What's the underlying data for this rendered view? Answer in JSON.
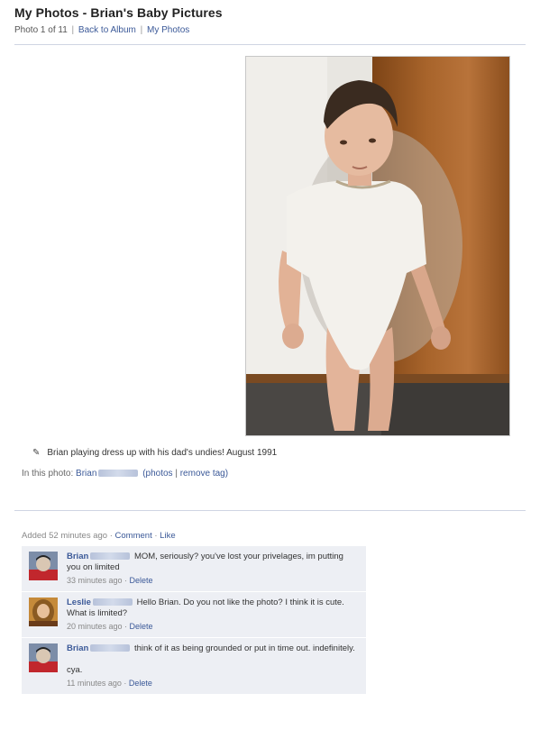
{
  "header": {
    "title": "My Photos - Brian's Baby Pictures",
    "photo_counter": "Photo 1 of 11",
    "back_link": "Back to Album",
    "my_photos_link": "My Photos"
  },
  "photo": {
    "caption": "Brian playing dress up with his dad's undies! August 1991",
    "in_this_photo_label": "In this photo:",
    "tagged_name": "Brian",
    "photos_link": "(photos",
    "remove_tag_link": "remove tag)"
  },
  "activity": {
    "added": "Added 52 minutes ago",
    "comment_link": "Comment",
    "like_link": "Like"
  },
  "comments": [
    {
      "name": "Brian",
      "text": "MOM, seriously? you've lost your privelages, im putting you on limited",
      "time": "33 minutes ago",
      "delete": "Delete",
      "avatar": "brian-avatar"
    },
    {
      "name": "Leslie",
      "text": "Hello Brian. Do you not like the photo? I think it is cute. What is limited?",
      "time": "20 minutes ago",
      "delete": "Delete",
      "avatar": "leslie-avatar"
    },
    {
      "name": "Brian",
      "text": "think of it as being grounded or put in time out. indefinitely.",
      "text2": "cya.",
      "time": "11 minutes ago",
      "delete": "Delete",
      "avatar": "brian-avatar"
    }
  ],
  "colors": {
    "link": "#3b5998",
    "comment_bg": "#edeff4"
  }
}
